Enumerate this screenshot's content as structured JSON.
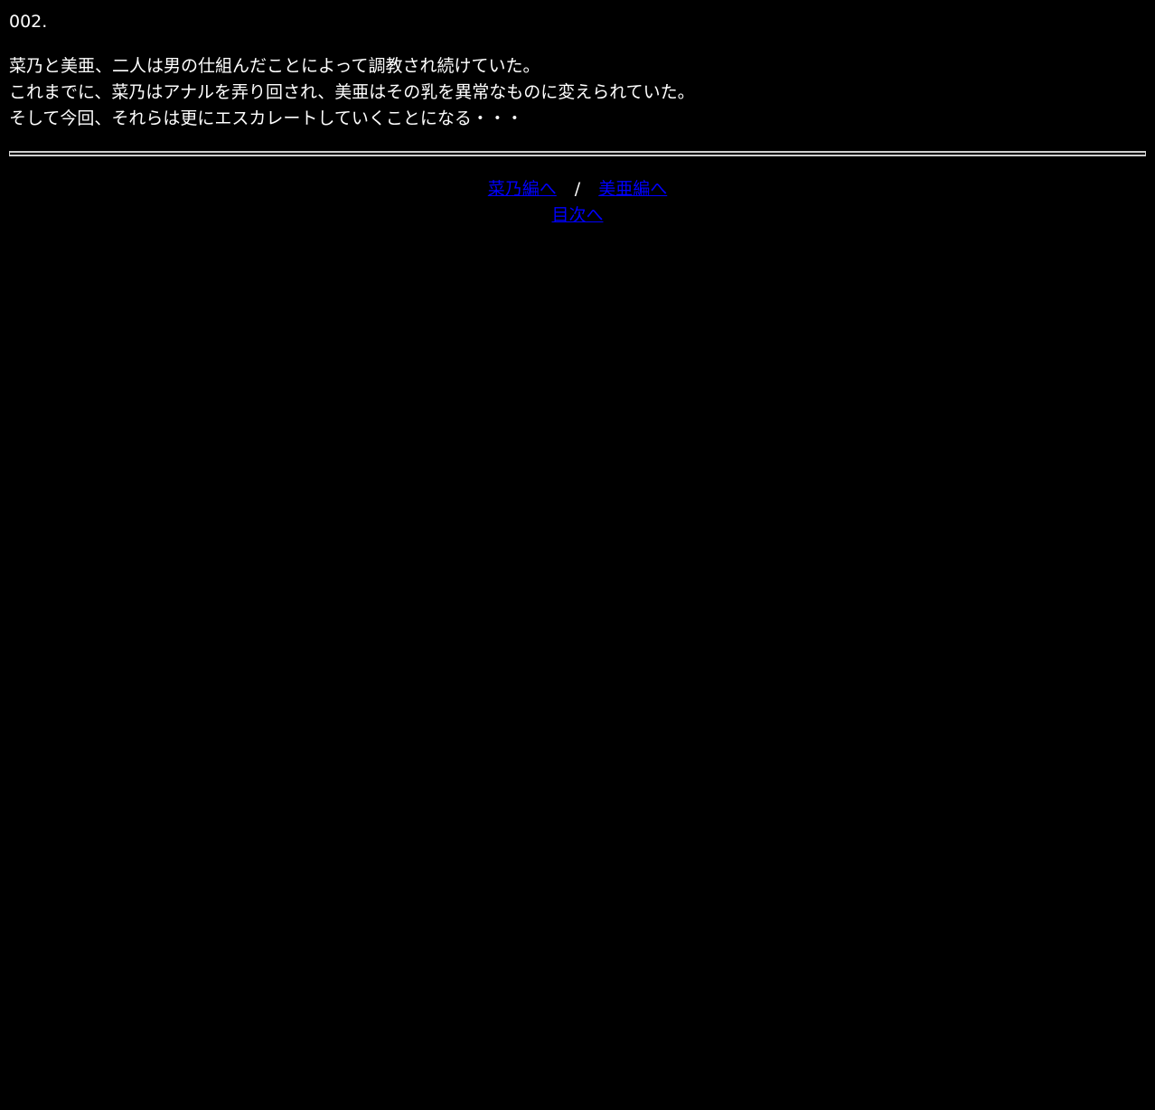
{
  "episode": {
    "number": "002."
  },
  "synopsis": {
    "lines": [
      "菜乃と美亜、二人は男の仕組んだことによって調教され続けていた。",
      "これまでに、菜乃はアナルを弄り回され、美亜はその乳を異常なものに変えられていた。",
      "そして今回、それらは更にエスカレートしていくことになる・・・"
    ]
  },
  "nav": {
    "nano_link": "菜乃編へ",
    "separator": "/",
    "mia_link": "美亜編へ",
    "toc_link": "目次へ"
  },
  "colors": {
    "background": "#000000",
    "text": "#ffffff",
    "link": "#0000ff",
    "rule": "#cfcfcf"
  }
}
